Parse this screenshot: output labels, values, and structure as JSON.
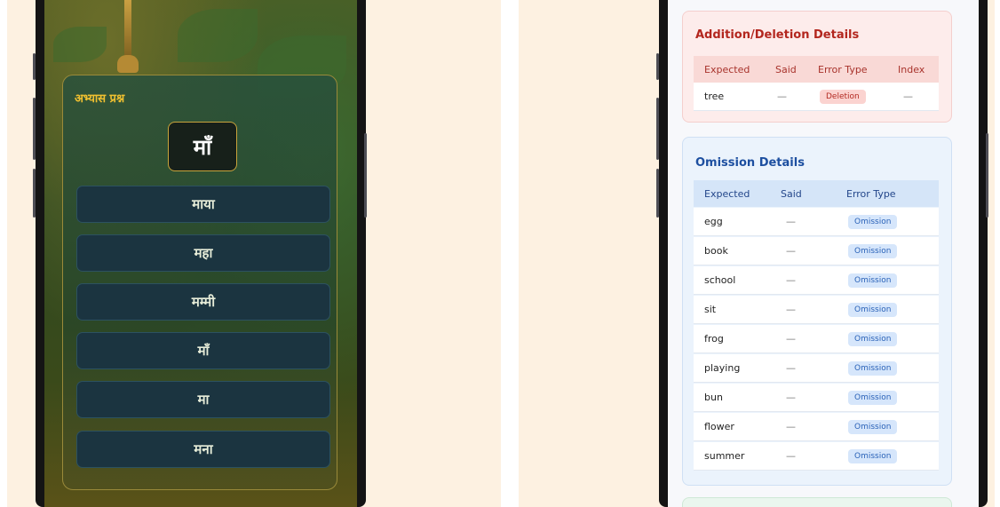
{
  "left": {
    "quiz_title": "अभ्यास प्रश्न",
    "prompt_letter": "माँ",
    "options": [
      "माया",
      "महा",
      "मम्मी",
      "माँ",
      "मा",
      "मना"
    ]
  },
  "addition_deletion": {
    "title": "Addition/Deletion Details",
    "headers": [
      "Expected",
      "Said",
      "Error Type",
      "Index"
    ],
    "rows": [
      {
        "expected": "tree",
        "said": "—",
        "error_type": "Deletion",
        "index": "—"
      }
    ]
  },
  "omission": {
    "title": "Omission Details",
    "headers": [
      "Expected",
      "Said",
      "Error Type"
    ],
    "rows": [
      {
        "expected": "egg",
        "said": "—",
        "error_type": "Omission"
      },
      {
        "expected": "book",
        "said": "—",
        "error_type": "Omission"
      },
      {
        "expected": "school",
        "said": "—",
        "error_type": "Omission"
      },
      {
        "expected": "sit",
        "said": "—",
        "error_type": "Omission"
      },
      {
        "expected": "frog",
        "said": "—",
        "error_type": "Omission"
      },
      {
        "expected": "playing",
        "said": "—",
        "error_type": "Omission"
      },
      {
        "expected": "bun",
        "said": "—",
        "error_type": "Omission"
      },
      {
        "expected": "flower",
        "said": "—",
        "error_type": "Omission"
      },
      {
        "expected": "summer",
        "said": "—",
        "error_type": "Omission"
      }
    ]
  },
  "colors": {
    "quiz_title": "#f0c030",
    "deletion_badge": "#fbd3d0",
    "omission_badge": "#d6e6fb",
    "addition_title": "#b3261e",
    "omission_title": "#1d4fa0"
  }
}
